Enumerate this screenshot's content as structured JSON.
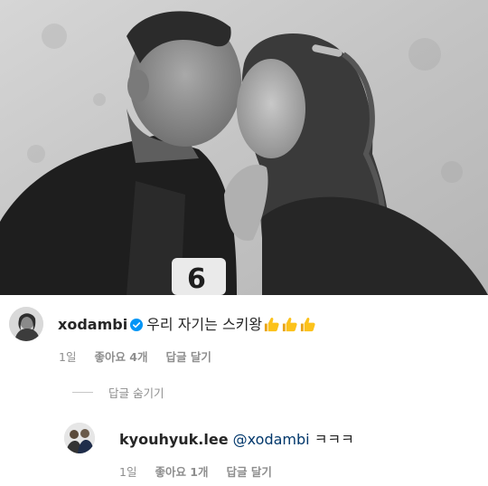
{
  "post": {
    "image_icon": "photo-couple-kiss-monochrome"
  },
  "comment": {
    "username": "xodambi",
    "verified_icon": "verified-badge-icon",
    "text": "우리 자기는 스키왕",
    "emoji": [
      "thumbs-up-icon",
      "thumbs-up-icon",
      "thumbs-up-icon"
    ],
    "time": "1일",
    "likes": "좋아요 4개",
    "reply": "답글 달기"
  },
  "replies_toggle": {
    "label": "답글 숨기기"
  },
  "reply": {
    "username": "kyouhyuk.lee",
    "mention": "@xodambi",
    "text": "ㅋㅋㅋ",
    "time": "1일",
    "likes": "좋아요 1개",
    "reply": "답글 달기"
  },
  "colors": {
    "text": "#262626",
    "meta": "#8e8e8e",
    "mention": "#00376b",
    "verified": "#0095f6"
  }
}
